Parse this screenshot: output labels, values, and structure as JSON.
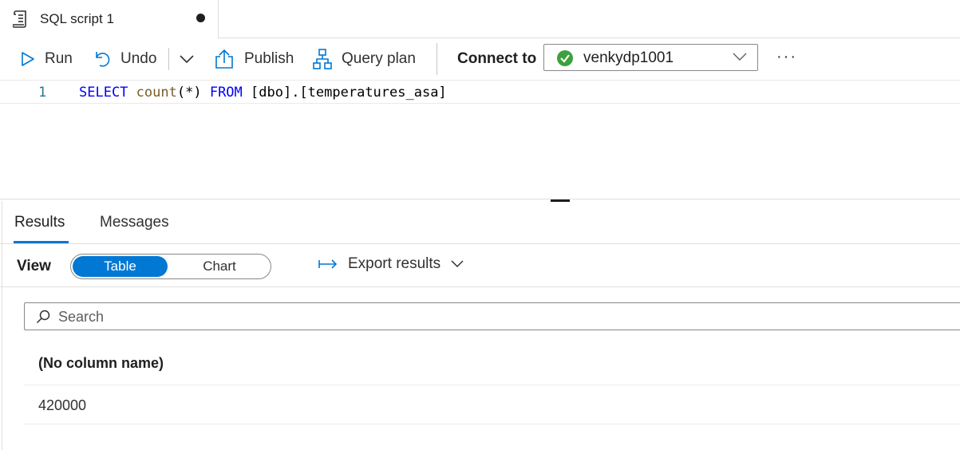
{
  "tab": {
    "title": "SQL script 1"
  },
  "toolbar": {
    "run_label": "Run",
    "undo_label": "Undo",
    "publish_label": "Publish",
    "query_plan_label": "Query plan",
    "connect_label": "Connect to",
    "connection_value": "venkydp1001",
    "more_label": "···",
    "status_color": "#3da13d"
  },
  "editor": {
    "line_number": "1",
    "tokens": {
      "select": "SELECT",
      "count": "count",
      "args": "(*)",
      "from": "FROM",
      "table": "[dbo].[temperatures_asa]"
    }
  },
  "results": {
    "tabs": [
      "Results",
      "Messages"
    ],
    "active_tab": "Results",
    "view_label": "View",
    "view_options": [
      "Table",
      "Chart"
    ],
    "selected_view": "Table",
    "export_label": "Export results",
    "search_placeholder": "Search",
    "columns": [
      "(No column name)"
    ],
    "rows": [
      [
        "420000"
      ]
    ]
  },
  "colors": {
    "accent": "#0078d4",
    "keyword": "#0000ff",
    "function": "#795e26"
  }
}
